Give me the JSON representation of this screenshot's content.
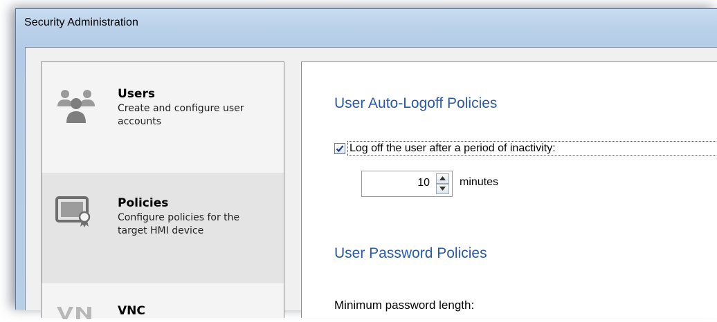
{
  "window": {
    "title": "Security Administration"
  },
  "nav": {
    "items": [
      {
        "title": "Users",
        "description": "Create and configure user accounts",
        "icon": "users-icon",
        "selected": false
      },
      {
        "title": "Policies",
        "description": "Configure policies for the target HMI device",
        "icon": "policies-device-icon",
        "selected": true
      },
      {
        "title": "VNC",
        "description": "",
        "icon": "vnc-icon",
        "selected": false
      }
    ]
  },
  "auto_logoff": {
    "heading": "User Auto-Logoff Policies",
    "checkbox_label": "Log off the user after a period of inactivity:",
    "checkbox_checked": true,
    "timeout_value": "10",
    "timeout_unit": "minutes"
  },
  "password": {
    "heading": "User Password Policies",
    "min_length_label": "Minimum password length:"
  },
  "colors": {
    "heading_blue": "#2a5aa6",
    "title_bar": "#bad1ea",
    "selected_item": "#e4e4e4"
  }
}
